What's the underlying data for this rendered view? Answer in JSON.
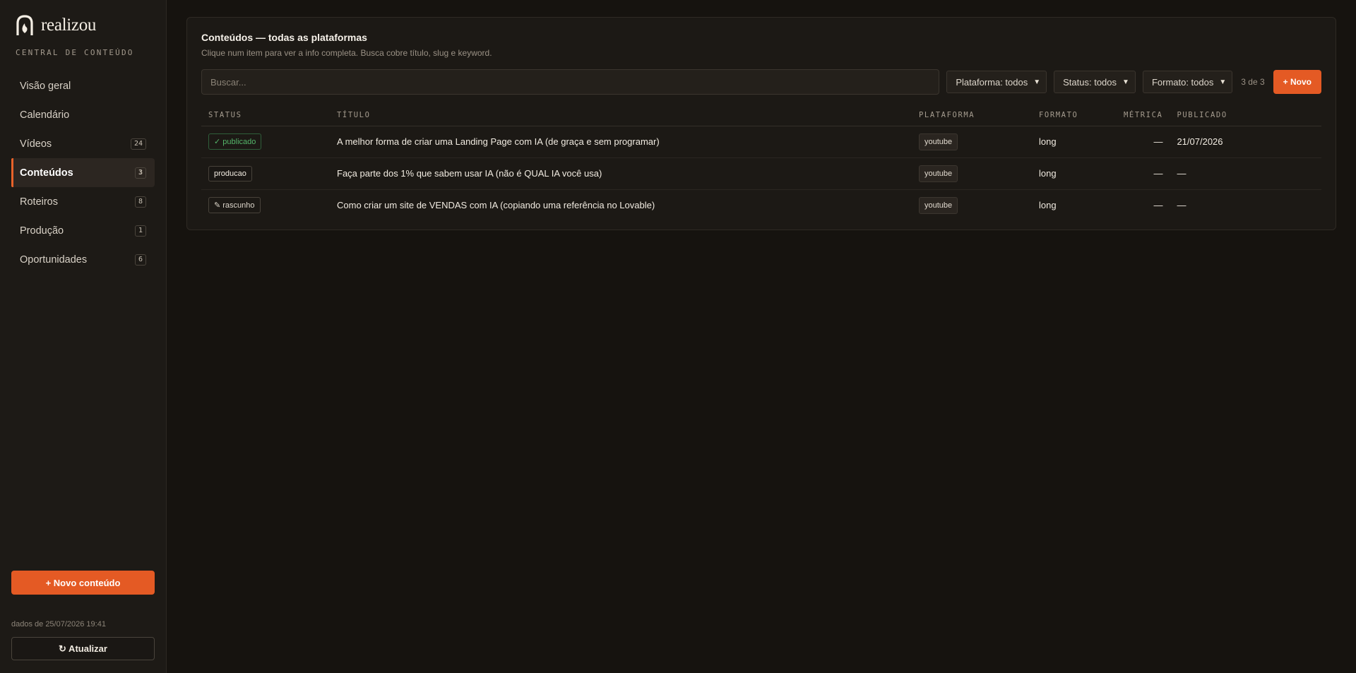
{
  "brand": {
    "name": "realizou",
    "subtitle": "CENTRAL DE CONTEÚDO"
  },
  "nav": [
    {
      "label": "Visão geral",
      "badge": ""
    },
    {
      "label": "Calendário",
      "badge": ""
    },
    {
      "label": "Vídeos",
      "badge": "24"
    },
    {
      "label": "Conteúdos",
      "badge": "3",
      "active": true
    },
    {
      "label": "Roteiros",
      "badge": "8"
    },
    {
      "label": "Produção",
      "badge": "1"
    },
    {
      "label": "Oportunidades",
      "badge": "6"
    }
  ],
  "sidebar": {
    "new_content": "+ Novo conteúdo",
    "data_stamp": "dados de 25/07/2026 19:41",
    "refresh": "↻ Atualizar"
  },
  "panel": {
    "title": "Conteúdos — todas as plataformas",
    "subtitle": "Clique num item para ver a info completa. Busca cobre título, slug e keyword."
  },
  "toolbar": {
    "search_placeholder": "Buscar...",
    "platform_filter": "Plataforma: todos",
    "status_filter": "Status: todos",
    "format_filter": "Formato: todos",
    "count": "3 de 3",
    "new_button": "+ Novo"
  },
  "table": {
    "headers": [
      "STATUS",
      "TÍTULO",
      "PLATAFORMA",
      "FORMATO",
      "MÉTRICA",
      "PUBLICADO"
    ],
    "rows": [
      {
        "status": "✓ publicado",
        "title": "A melhor forma de criar uma Landing Page com IA (de graça e sem programar)",
        "platform": "youtube",
        "format": "long",
        "metric": "—",
        "published": "21/07/2026"
      },
      {
        "status": "producao",
        "title": "Faça parte dos 1% que sabem usar IA (não é QUAL IA você usa)",
        "platform": "youtube",
        "format": "long",
        "metric": "—",
        "published": "—"
      },
      {
        "status": "✎ rascunho",
        "title": "Como criar um site de VENDAS com IA (copiando uma referência no Lovable)",
        "platform": "youtube",
        "format": "long",
        "metric": "—",
        "published": "—"
      }
    ]
  },
  "colors": {
    "accent": "#e45a24",
    "published": "#55b56a",
    "background": "#16130f"
  }
}
